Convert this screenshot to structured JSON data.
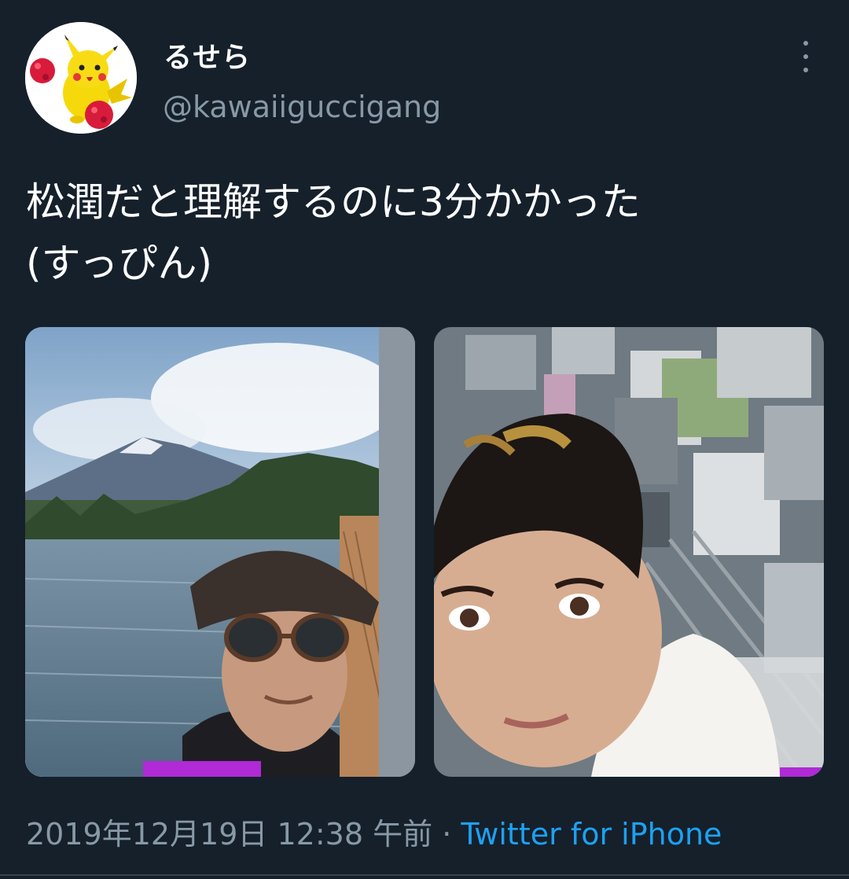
{
  "user": {
    "display_name": "るせら",
    "handle": "@kawaiiguccigang",
    "avatar_icon": "pikachu-avatar"
  },
  "menu": {
    "icon": "more-vertical-icon"
  },
  "tweet": {
    "text_line1": "松潤だと理解するのに3分かかった",
    "text_line2": "(すっぴん)"
  },
  "media": [
    {
      "description_icon": "photo-mount-fuji-selfie"
    },
    {
      "description_icon": "photo-city-rooftop-selfie"
    }
  ],
  "meta": {
    "timestamp": "2019年12月19日 12:38 午前",
    "separator": "·",
    "source": "Twitter for iPhone"
  },
  "colors": {
    "background": "#15202b",
    "secondary_text": "#8899a6",
    "link": "#1da1f2"
  }
}
